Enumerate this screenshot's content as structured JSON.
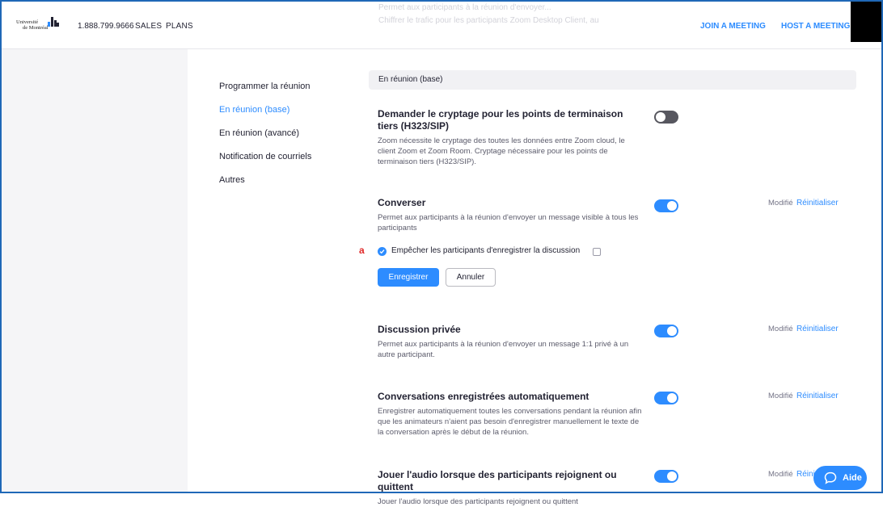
{
  "header": {
    "logo": "Université de Montréal",
    "logo_line1": "Université",
    "logo_line2": "de Montréal",
    "phone": "1.888.799.9666",
    "sales": "SALES",
    "plans": "PLANS",
    "join": "JOIN A MEETING",
    "host": "HOST A MEETING",
    "ghost_lines": [
      "Permet aux participants à la réunion d'envoyer...",
      "Chiffrer le trafic pour les participants Zoom Desktop Client, au"
    ]
  },
  "subnav": {
    "items": [
      {
        "label": "Programmer la réunion",
        "active": false
      },
      {
        "label": "En réunion (base)",
        "active": true
      },
      {
        "label": "En réunion (avancé)",
        "active": false
      },
      {
        "label": "Notification de courriels",
        "active": false
      },
      {
        "label": "Autres",
        "active": false
      }
    ]
  },
  "section": {
    "title": "En réunion (base)"
  },
  "settings": {
    "encryption": {
      "title": "Demander le cryptage pour les points de terminaison tiers (H323/SIP)",
      "desc": "Zoom nécessite le cryptage des toutes les données entre Zoom cloud, le client Zoom et Zoom Room. Cryptage nécessaire pour les points de terminaison tiers (H323/SIP).",
      "enabled": false
    },
    "chat": {
      "title": "Converser",
      "desc": "Permet aux participants à la réunion d'envoyer un message visible à tous les participants",
      "enabled": true,
      "modified": "Modifié",
      "reset": "Réinitialiser",
      "marker": "a",
      "option_label": "Empêcher les participants d'enregistrer la discussion",
      "option_checked": true,
      "save": "Enregistrer",
      "cancel": "Annuler"
    },
    "private_chat": {
      "title": "Discussion privée",
      "desc": "Permet aux participants à la réunion d'envoyer un message 1:1 privé à un autre participant.",
      "enabled": true,
      "modified": "Modifié",
      "reset": "Réinitialiser"
    },
    "auto_save_chat": {
      "title": "Conversations enregistrées automatiquement",
      "desc": "Enregistrer automatiquement toutes les conversations pendant la réunion afin que les animateurs n'aient pas besoin d'enregistrer manuellement le texte de la conversation après le début de la réunion.",
      "enabled": true,
      "modified": "Modifié",
      "reset": "Réinitialiser"
    },
    "join_audio": {
      "title": "Jouer l'audio lorsque des participants rejoignent ou quittent",
      "desc": "Jouer l'audio lorsque des participants rejoignent ou quittent",
      "enabled": true,
      "modified": "Modifié",
      "reset": "Réinitialiser"
    }
  },
  "help": {
    "label": "Aide",
    "icon": "chat-bubble-icon"
  },
  "colors": {
    "accent": "#2d8cff",
    "toggle_off": "#57575f",
    "marker": "#e02828"
  }
}
